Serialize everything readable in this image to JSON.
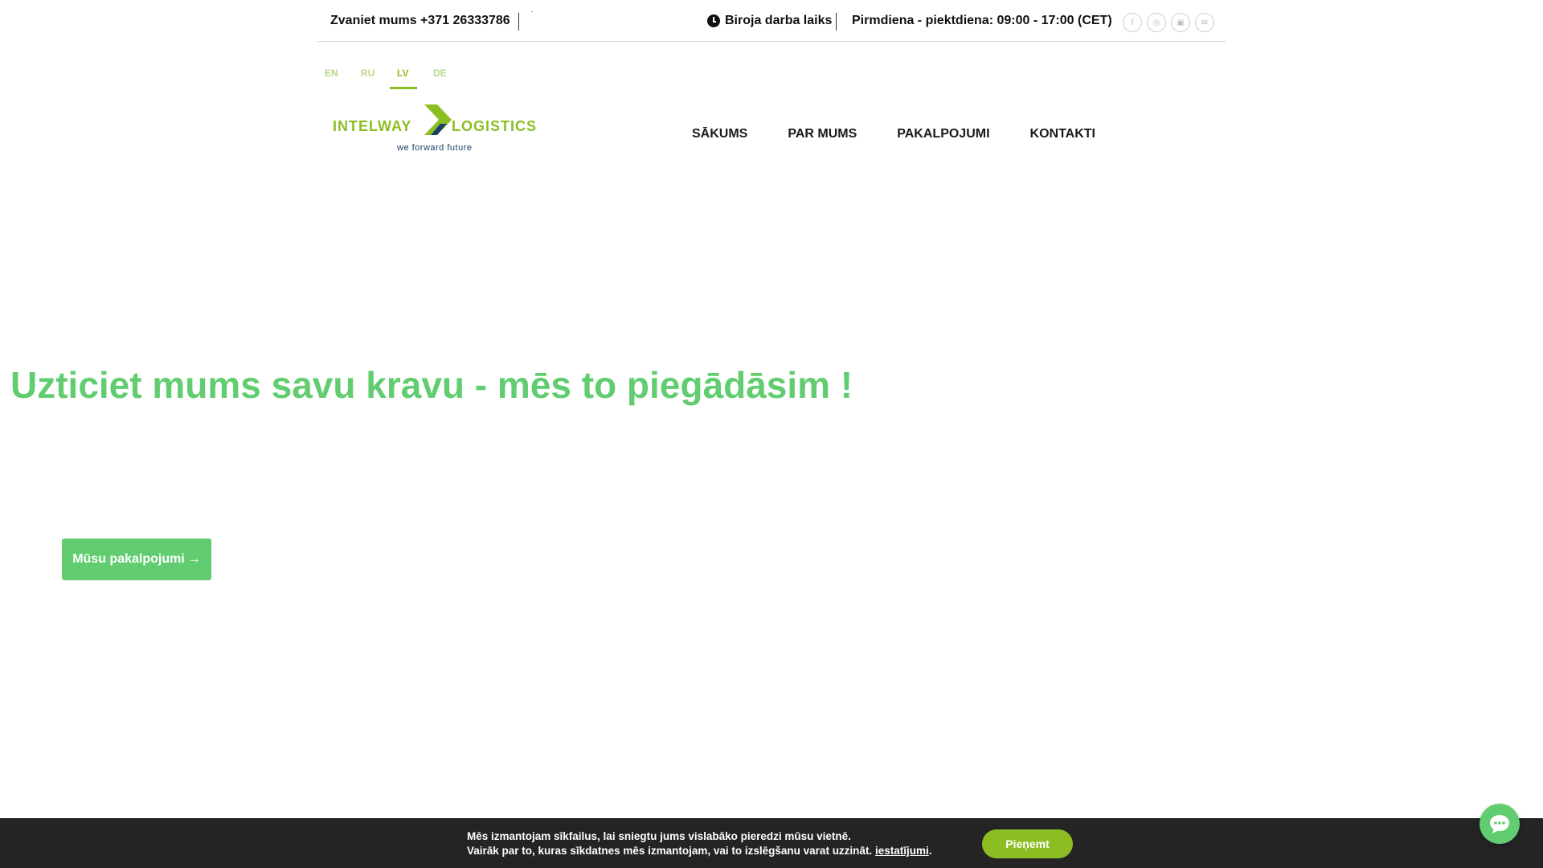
{
  "topbar": {
    "phone": "Zvaniet mums +371 26333786",
    "hours_label": "Biroja darba laiks",
    "hours": "Pirmdiena - piektdiena: 09:00 - 17:00 (CET)",
    "socials": [
      "facebook-icon",
      "instagram-icon",
      "linkedin-icon",
      "email-icon"
    ]
  },
  "languages": [
    {
      "code": "EN",
      "active": false
    },
    {
      "code": "RU",
      "active": false
    },
    {
      "code": "LV",
      "active": true
    },
    {
      "code": "DE",
      "active": false
    }
  ],
  "logo": {
    "left": "INTELWAY",
    "right": "LOGISTICS",
    "tagline": "we forward future"
  },
  "nav": {
    "items": [
      "SĀKUMS",
      "PAR MUMS",
      "PAKALPOJUMI",
      "KONTAKTI"
    ]
  },
  "hero": {
    "title": "Uzticiet mums savu kravu - mēs to piegādāsim !",
    "button_label": "Mūsu pakalpojumi"
  },
  "cookie": {
    "line1": "Mēs izmantojam sīkfailus, lai sniegtu jums vislabāko pieredzi mūsu vietnē.",
    "line2": "Vairāk par to, kuras sīkdatnes mēs izmantojam, vai to izslēgšanu varat uzzināt.",
    "settings_link": "iestatījumi",
    "accept_label": "Pieņemt"
  },
  "colors": {
    "brand_green": "#8cbe23",
    "hero_green": "#62cd70",
    "logo_blue": "#1d3f6b",
    "cookie_bg": "#242424"
  }
}
